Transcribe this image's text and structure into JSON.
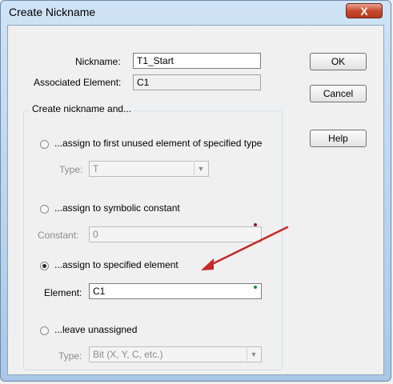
{
  "window": {
    "title": "Create Nickname",
    "close_label": "X"
  },
  "form": {
    "nickname_label": "Nickname:",
    "nickname_value": "T1_Start",
    "associated_label": "Associated Element:",
    "associated_value": "C1"
  },
  "buttons": {
    "ok": "OK",
    "cancel": "Cancel",
    "help": "Help"
  },
  "group": {
    "legend": "Create nickname and...",
    "options": [
      {
        "label": "...assign to first unused element of specified type",
        "selected": false,
        "field_label": "Type:",
        "field_value": "T"
      },
      {
        "label": "...assign to symbolic constant",
        "selected": false,
        "field_label": "Constant:",
        "field_value": "0"
      },
      {
        "label": "...assign to specified element",
        "selected": true,
        "field_label": "Element:",
        "field_value": "C1"
      },
      {
        "label": "...leave unassigned",
        "selected": false,
        "field_label": "Type:",
        "field_value": "Bit (X, Y, C, etc.)"
      }
    ]
  },
  "colors": {
    "arrow": "#c62828",
    "constant_dot": "#8b1a1a",
    "element_dot": "#1f8a3a"
  }
}
